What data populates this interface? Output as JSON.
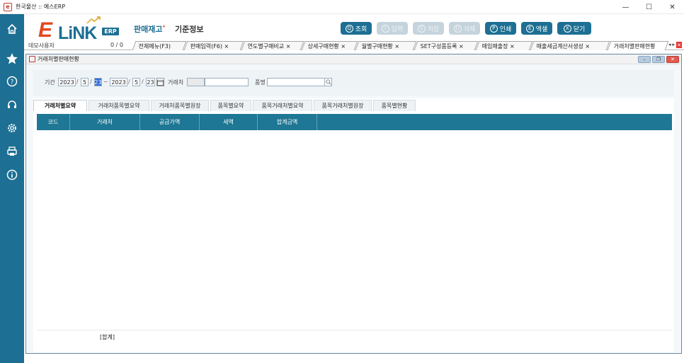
{
  "window": {
    "title": "한국물산 :: 예스ERP",
    "minimize": "—",
    "maximize": "☐",
    "close": "✕"
  },
  "sidebar": {
    "icons": [
      "home-icon",
      "star-icon",
      "help-icon",
      "headset-icon",
      "settings-icon",
      "printer-icon",
      "info-icon"
    ]
  },
  "header": {
    "logo_e": "E",
    "logo_link": "LiNK",
    "logo_erp": "ERP",
    "module": "판매재고",
    "module_mark": "*",
    "submodule": "기준정보",
    "toolbar": [
      {
        "key": "Q",
        "label": "조회",
        "enabled": true
      },
      {
        "key": "I",
        "label": "입력",
        "enabled": false
      },
      {
        "key": "S",
        "label": "저장",
        "enabled": false
      },
      {
        "key": "D",
        "label": "삭제",
        "enabled": false
      },
      {
        "key": "P",
        "label": "인쇄",
        "enabled": true
      },
      {
        "key": "E",
        "label": "엑셀",
        "enabled": true
      },
      {
        "key": "X",
        "label": "닫기",
        "enabled": true
      }
    ]
  },
  "tabsrow": {
    "user": "데모사용자",
    "count": "0 / 0",
    "tabs": [
      {
        "label": "전체메뉴(F3)"
      },
      {
        "label": "판매입력(F6) ×"
      },
      {
        "label": "연도별구매비교 ×"
      },
      {
        "label": "상세구매현황 ×"
      },
      {
        "label": "월별구매현황 ×"
      },
      {
        "label": "SET구성품등록 ×"
      },
      {
        "label": "매입매출장 ×"
      },
      {
        "label": "매출세금계산서생성 ×"
      },
      {
        "label": "거래처별판매현황"
      }
    ]
  },
  "form": {
    "title": "거래처별판매현황",
    "filter": {
      "period_label": "기간",
      "from_year": "2023",
      "from_month": "5",
      "from_day": "23",
      "to_year": "2023",
      "to_month": "5",
      "to_day": "23",
      "customer_label": "거래처",
      "item_label": "품명"
    },
    "content_tabs": [
      "거래처별요약",
      "거래처품목별요약",
      "거래처품목별원장",
      "품목별요약",
      "품목거래처별요약",
      "품목거래처별원장",
      "품목별현황"
    ],
    "columns": [
      "코드",
      "거래처",
      "공급가액",
      "세액",
      "합계금액"
    ],
    "total_label": "[합계]"
  },
  "colors": {
    "accent": "#1d6f93",
    "brand_orange": "#e2471e",
    "grid_header": "#1e7794"
  }
}
